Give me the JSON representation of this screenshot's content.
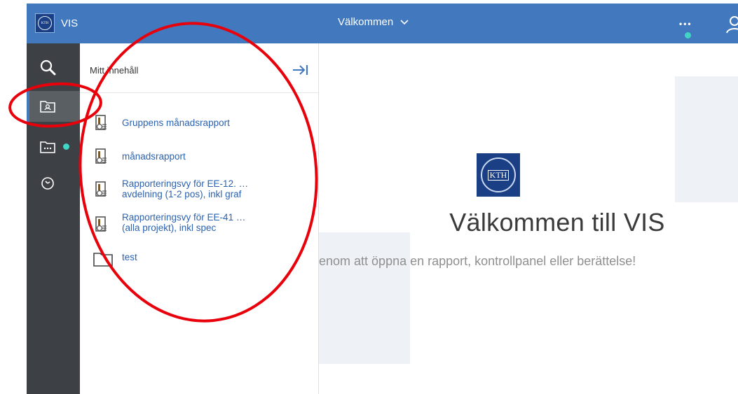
{
  "app": {
    "name": "VIS",
    "logo_text": "KTH"
  },
  "header": {
    "menu_label": "Välkommen",
    "more_label": "•••"
  },
  "rail": {
    "items": [
      {
        "name": "search",
        "icon": "search-icon"
      },
      {
        "name": "my-content",
        "icon": "folder-user-icon",
        "active": true
      },
      {
        "name": "team-content",
        "icon": "folder-more-icon"
      },
      {
        "name": "recent",
        "icon": "clock-icon"
      }
    ]
  },
  "panel": {
    "title": "Mitt innehåll",
    "items": [
      {
        "type": "report",
        "label": "Gruppens månadsrapport"
      },
      {
        "type": "report",
        "label": "månadsrapport"
      },
      {
        "type": "report",
        "label_line1": "Rapporteringsvy för EE-12. …",
        "label_line2": "avdelning (1-2 pos), inkl graf"
      },
      {
        "type": "report",
        "label_line1": "Rapporteringsvy för EE-41 …",
        "label_line2": "(alla projekt), inkl spec"
      },
      {
        "type": "folder",
        "label": "test"
      }
    ]
  },
  "main": {
    "logo_text": "KTH",
    "title": "Välkommen till VIS",
    "subtitle": "enom att öppna en rapport, kontrollpanel eller berättelse!"
  },
  "colors": {
    "header": "#4178be",
    "rail": "#3d4145",
    "link": "#2b62b0",
    "status_dot": "#41d6c3",
    "annotation": "#e8000b"
  }
}
